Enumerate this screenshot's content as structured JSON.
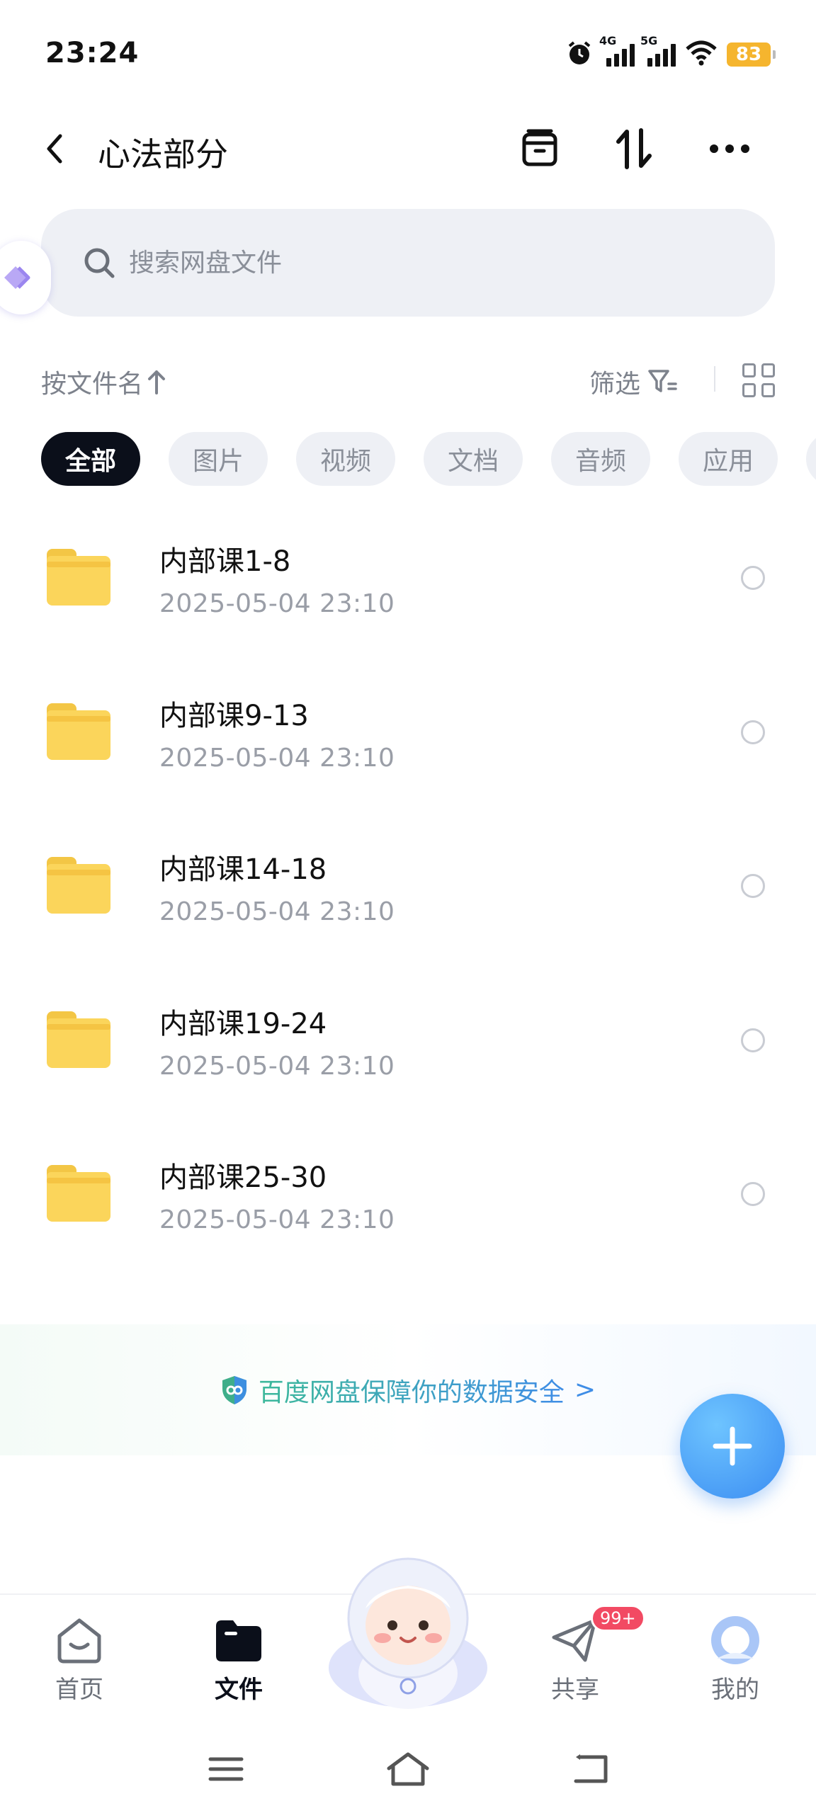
{
  "status_bar": {
    "time": "23:24",
    "network1": "4G",
    "network2": "5G",
    "battery": "83",
    "icons": [
      "alarm-icon",
      "signal-4g-icon",
      "signal-5g-icon",
      "wifi-icon",
      "battery-icon"
    ]
  },
  "header": {
    "title": "心法部分",
    "actions": [
      "archive-icon",
      "sort-icon",
      "more-icon"
    ]
  },
  "search": {
    "placeholder": "搜索网盘文件"
  },
  "sort_bar": {
    "sort_label": "按文件名",
    "filter_label": "筛选"
  },
  "categories": [
    {
      "label": "全部",
      "active": true
    },
    {
      "label": "图片",
      "active": false
    },
    {
      "label": "视频",
      "active": false
    },
    {
      "label": "文档",
      "active": false
    },
    {
      "label": "音频",
      "active": false
    },
    {
      "label": "应用",
      "active": false
    }
  ],
  "files": [
    {
      "name": "内部课1-8",
      "date": "2025-05-04  23:10"
    },
    {
      "name": "内部课9-13",
      "date": "2025-05-04  23:10"
    },
    {
      "name": "内部课14-18",
      "date": "2025-05-04  23:10"
    },
    {
      "name": "内部课19-24",
      "date": "2025-05-04  23:10"
    },
    {
      "name": "内部课25-30",
      "date": "2025-05-04  23:10"
    }
  ],
  "security_banner": {
    "text": "百度网盘保障你的数据安全",
    "arrow": ">"
  },
  "bottom_nav": {
    "items": [
      {
        "label": "首页",
        "active": false
      },
      {
        "label": "文件",
        "active": true
      },
      {
        "label": "共享",
        "active": false,
        "badge": "99+"
      },
      {
        "label": "我的",
        "active": false
      }
    ]
  },
  "colors": {
    "accent_dark": "#0b0f1a",
    "folder": "#fbd55b",
    "fab": "#3b8df2",
    "badge": "#f24a63",
    "banner_text": "#3db99a"
  }
}
